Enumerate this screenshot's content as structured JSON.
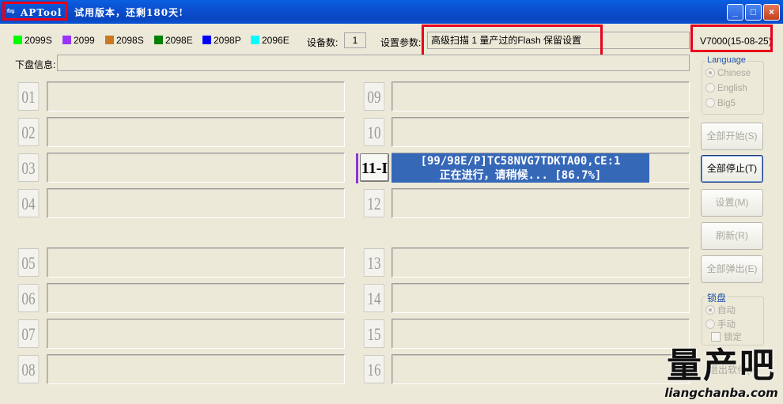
{
  "window": {
    "app_name": "APTool",
    "trial_text": "试用版本，还剩180天!",
    "min_btn": "_",
    "max_btn": "□",
    "close_btn": "×"
  },
  "legend": [
    {
      "label": "2099S",
      "color": "#00ff00"
    },
    {
      "label": "2099",
      "color": "#9933ff"
    },
    {
      "label": "2098S",
      "color": "#cc7722"
    },
    {
      "label": "2098E",
      "color": "#008000"
    },
    {
      "label": "2098P",
      "color": "#0000ff"
    },
    {
      "label": "2096E",
      "color": "#00ffff"
    }
  ],
  "device_count": {
    "label": "设备数:",
    "value": "1"
  },
  "settings_param": {
    "label": "设置参数:",
    "value": "高级扫描 1 量产过的Flash 保留设置"
  },
  "version": "V7000(15-08-25)",
  "disk_info": {
    "label": "下盘信息:",
    "value": ""
  },
  "ports_left": [
    {
      "num": "01",
      "status": ""
    },
    {
      "num": "02",
      "status": ""
    },
    {
      "num": "03",
      "status": ""
    },
    {
      "num": "04",
      "status": ""
    },
    {
      "num": "05",
      "status": ""
    },
    {
      "num": "06",
      "status": ""
    },
    {
      "num": "07",
      "status": ""
    },
    {
      "num": "08",
      "status": ""
    }
  ],
  "ports_right": [
    {
      "num": "09",
      "status": ""
    },
    {
      "num": "10",
      "status": ""
    },
    {
      "num": "11-I",
      "status": "active"
    },
    {
      "num": "12",
      "status": ""
    },
    {
      "num": "13",
      "status": ""
    },
    {
      "num": "14",
      "status": ""
    },
    {
      "num": "15",
      "status": ""
    },
    {
      "num": "16",
      "status": ""
    }
  ],
  "active_port": {
    "line1": "[99/98E/P]TC58NVG7TDKTA00,CE:1",
    "line2": "正在进行，请稍候... [86.7%]",
    "progress_percent": 86.7
  },
  "language": {
    "title": "Language",
    "options": [
      "Chinese",
      "English",
      "Big5"
    ],
    "selected": "Chinese"
  },
  "buttons": {
    "start_all": "全部开始(S)",
    "stop_all": "全部停止(T)",
    "settings": "设置(M)",
    "refresh": "刷新(R)",
    "eject_all": "全部弹出(E)",
    "exit": "退出软件(X)"
  },
  "lock": {
    "title": "锁盘",
    "auto": "自动",
    "manual": "手动",
    "lock_check": "锁定"
  },
  "watermark": {
    "big": "量产吧",
    "small": "liangchanba.com"
  }
}
